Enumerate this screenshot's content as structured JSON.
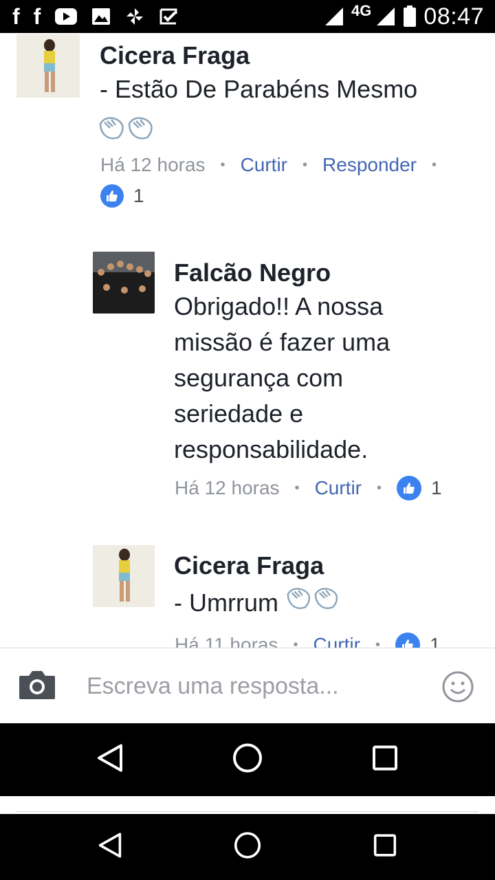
{
  "status_bar": {
    "network": "4G",
    "time": "08:47",
    "notification_icons": [
      "facebook-icon",
      "facebook-icon",
      "youtube-icon",
      "image-icon",
      "pinwheel-icon",
      "checkmark-app-icon"
    ]
  },
  "comments": [
    {
      "author": "Cicera Fraga",
      "text": "- Estão De Parabéns Mesmo",
      "time": "Há 12 horas",
      "like_label": "Curtir",
      "reply_label": "Responder",
      "likes": "1"
    },
    {
      "author": "Falcão Negro",
      "text_lines": [
        "Obrigado!! A nossa",
        "missão é fazer uma",
        "segurança com",
        "seriedade e",
        "responsabilidade."
      ],
      "time": "Há 12 horas",
      "like_label": "Curtir",
      "likes": "1"
    },
    {
      "author": "Cicera Fraga",
      "text": "- Umrrum",
      "time": "Há 11 horas",
      "like_label": "Curtir",
      "likes": "1"
    }
  ],
  "reply_bar": {
    "placeholder": "Escreva uma resposta..."
  },
  "colors": {
    "accent": "#4267b2",
    "like_badge": "#3b82f0",
    "meta_text": "#90949c"
  }
}
